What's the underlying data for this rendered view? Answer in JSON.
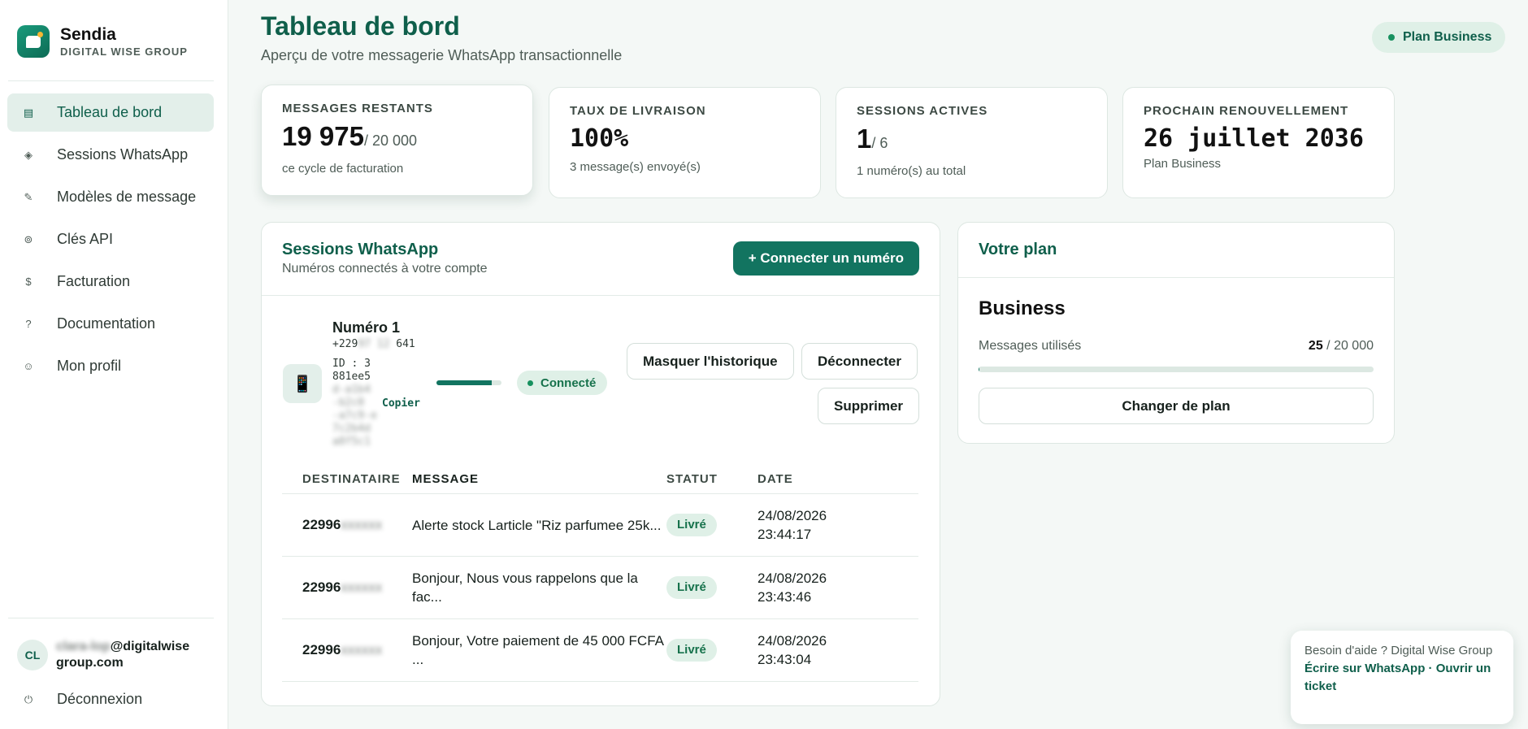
{
  "brand": {
    "name": "Sendia",
    "subtitle": "DIGITAL WISE GROUP"
  },
  "nav": [
    {
      "label": "Tableau de bord",
      "icon": "dashboard-icon",
      "glyph": "▤",
      "active": true
    },
    {
      "label": "Sessions WhatsApp",
      "icon": "sessions-icon",
      "glyph": "◈",
      "active": false
    },
    {
      "label": "Modèles de message",
      "icon": "pencil-icon",
      "glyph": "✎",
      "active": false
    },
    {
      "label": "Clés API",
      "icon": "key-icon",
      "glyph": "⊚",
      "active": false
    },
    {
      "label": "Facturation",
      "icon": "dollar-icon",
      "glyph": "$",
      "active": false
    },
    {
      "label": "Documentation",
      "icon": "question-icon",
      "glyph": "?",
      "active": false
    },
    {
      "label": "Mon profil",
      "icon": "smiley-icon",
      "glyph": "☺",
      "active": false
    }
  ],
  "user": {
    "initials": "CL",
    "email_hidden": "clara-lop",
    "email_visible": "@digitalwisegroup.com"
  },
  "logout": {
    "label": "Déconnexion",
    "glyph": "⏻"
  },
  "header": {
    "title": "Tableau de bord",
    "subtitle": "Aperçu de votre messagerie WhatsApp transactionnelle",
    "plan_badge": "Plan Business"
  },
  "stats": [
    {
      "label": "MESSAGES RESTANTS",
      "value": "19 975",
      "of": "/ 20 000",
      "note": "ce cycle de facturation"
    },
    {
      "label": "TAUX DE LIVRAISON",
      "value": "100%",
      "of": "",
      "note": "3 message(s) envoyé(s)"
    },
    {
      "label": "SESSIONS ACTIVES",
      "value": "1",
      "of": "/ 6",
      "note": "1 numéro(s) au total"
    },
    {
      "label": "PROCHAIN RENOUVELLEMENT",
      "value": "26 juillet 2036",
      "of": "",
      "note": "Plan Business"
    }
  ],
  "sessions": {
    "title": "Sessions WhatsApp",
    "subtitle": "Numéros connectés à votre compte",
    "connect_label": "+ Connecter un numéro",
    "item": {
      "name": "Numéro 1",
      "phone_start": "+229",
      "phone_hidden": "97 12 ",
      "phone_end": "641",
      "id_prefix": "ID : 3",
      "id_line2": "881ee5",
      "id_hidden": [
        "d-a1b4",
        "-b2c0",
        "-a7c9-e",
        "7c2b4d",
        "a8f5c1"
      ],
      "copy_label": "Copier",
      "progress": 0.85,
      "status": "Connecté",
      "hide_history_label": "Masquer l'historique",
      "disconnect_label": "Déconnecter",
      "delete_label": "Supprimer",
      "icon": "phone-icon"
    },
    "table": {
      "headers": [
        "DESTINATAIRE",
        "MESSAGE",
        "STATUT",
        "DATE"
      ],
      "rows": [
        {
          "to": "22996",
          "to_hidden": "xxxxxx",
          "message": "Alerte stock Larticle \"Riz parfumee 25k...",
          "status": "Livré",
          "date": "24/08/2026",
          "time": "23:44:17"
        },
        {
          "to": "22996",
          "to_hidden": "xxxxxx",
          "message": "Bonjour, Nous vous rappelons que la fac...",
          "status": "Livré",
          "date": "24/08/2026",
          "time": "23:43:46"
        },
        {
          "to": "22996",
          "to_hidden": "xxxxxx",
          "message": "Bonjour, Votre paiement de 45 000 FCFA ...",
          "status": "Livré",
          "date": "24/08/2026",
          "time": "23:43:04"
        }
      ]
    }
  },
  "plan": {
    "title": "Votre plan",
    "name": "Business",
    "usage_label": "Messages utilisés",
    "used": "25",
    "limit": "/ 20 000",
    "usage_fraction": 0.00125,
    "change_label": "Changer de plan"
  },
  "help": {
    "text": "Besoin d'aide ? Digital Wise Group",
    "whatsapp_link": "Écrire sur WhatsApp",
    "separator": "·",
    "ticket_link": "Ouvrir un ticket"
  },
  "colors": {
    "brand": "#0f5f4b",
    "accent": "#127460",
    "status_green": "#17915f"
  }
}
